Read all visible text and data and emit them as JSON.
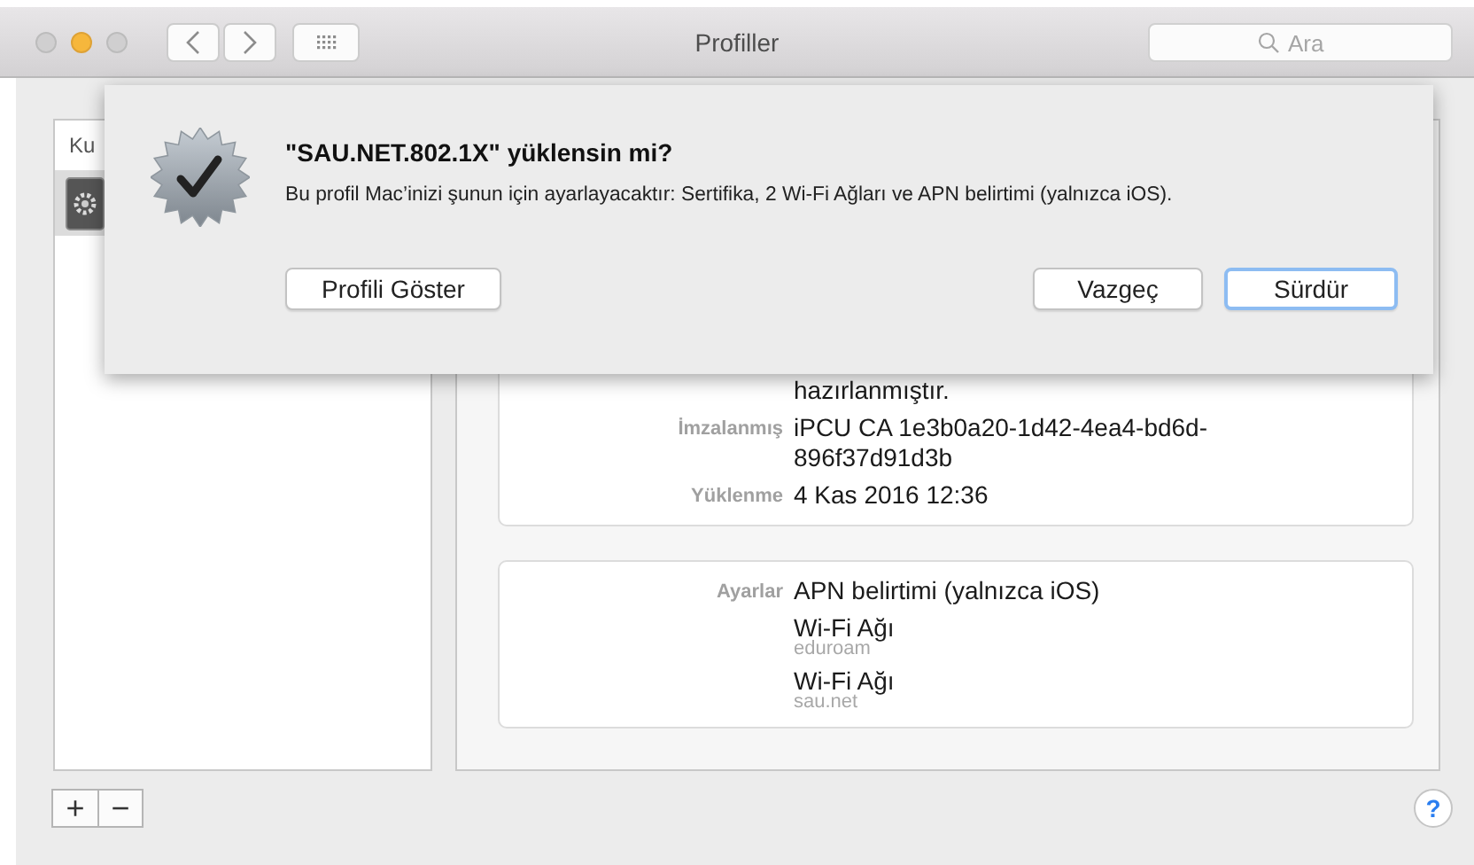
{
  "window": {
    "title": "Profiller",
    "search": {
      "placeholder": "Ara"
    }
  },
  "sidebar": {
    "header": "Ku",
    "items": [
      {
        "selected": true
      }
    ]
  },
  "details": {
    "cards": [
      {
        "rows": [
          {
            "entries": [
              {
                "text": "hazırlanmıştır."
              }
            ]
          },
          {
            "label": "İmzalanmış",
            "entries": [
              {
                "text": "iPCU CA 1e3b0a20-1d42-4ea4-bd6d-896f37d91d3b"
              }
            ]
          },
          {
            "label": "Yüklenme",
            "entries": [
              {
                "text": "4 Kas 2016 12:36"
              }
            ]
          }
        ]
      },
      {
        "rows": [
          {
            "label": "Ayarlar",
            "entries": [
              {
                "text": "APN belirtimi (yalnızca iOS)"
              },
              {
                "text": "Wi-Fi Ağı",
                "detail": "eduroam"
              },
              {
                "text": "Wi-Fi Ağı",
                "detail": "sau.net"
              }
            ]
          }
        ]
      }
    ]
  },
  "bottom_bar": {
    "buttons": [
      "+",
      "−"
    ],
    "help": "?"
  },
  "dialog": {
    "title": "\"SAU.NET.802.1X\" yüklensin mi?",
    "message": "Bu profil Mac’inizi şunun için ayarlayacaktır: Sertifika, 2 Wi-Fi Ağları ve APN belirtimi (yalnızca iOS).",
    "buttons": [
      {
        "label": "Profili Göster",
        "kind": "secondary"
      },
      {
        "label": "Vazgeç",
        "kind": "cancel"
      },
      {
        "label": "Sürdür",
        "kind": "default"
      }
    ]
  }
}
